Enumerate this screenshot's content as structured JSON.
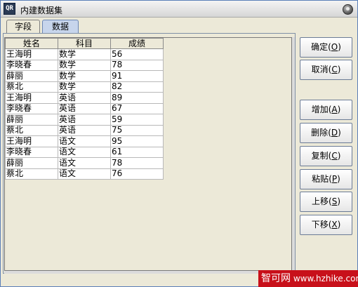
{
  "window": {
    "title": "内建数据集",
    "icon": "app-logo-icon"
  },
  "tabs": [
    {
      "label": "字段",
      "selected": false
    },
    {
      "label": "数据",
      "selected": true
    }
  ],
  "table": {
    "columns": [
      "姓名",
      "科目",
      "成绩"
    ],
    "rows": [
      [
        "王海明",
        "数学",
        "56"
      ],
      [
        "李晓春",
        "数学",
        "78"
      ],
      [
        "薛丽",
        "数学",
        "91"
      ],
      [
        "蔡北",
        "数学",
        "82"
      ],
      [
        "王海明",
        "英语",
        "89"
      ],
      [
        "李晓春",
        "英语",
        "67"
      ],
      [
        "薛丽",
        "英语",
        "59"
      ],
      [
        "蔡北",
        "英语",
        "75"
      ],
      [
        "王海明",
        "语文",
        "95"
      ],
      [
        "李晓春",
        "语文",
        "61"
      ],
      [
        "薛丽",
        "语文",
        "78"
      ],
      [
        "蔡北",
        "语文",
        "76"
      ]
    ]
  },
  "buttons": {
    "ok": {
      "label": "确定",
      "key": "O"
    },
    "cancel": {
      "label": "取消",
      "key": "C"
    },
    "add": {
      "label": "增加",
      "key": "A"
    },
    "delete": {
      "label": "删除",
      "key": "D"
    },
    "copy": {
      "label": "复制",
      "key": "C"
    },
    "paste": {
      "label": "粘贴",
      "key": "P"
    },
    "move_up": {
      "label": "上移",
      "key": "S"
    },
    "move_down": {
      "label": "下移",
      "key": "X"
    }
  },
  "watermark": {
    "cn": "智可网",
    "url": "www.hzhike.com"
  },
  "colors": {
    "selected_tab": "#c7d5ec",
    "watermark_bg": "#c8101a"
  }
}
